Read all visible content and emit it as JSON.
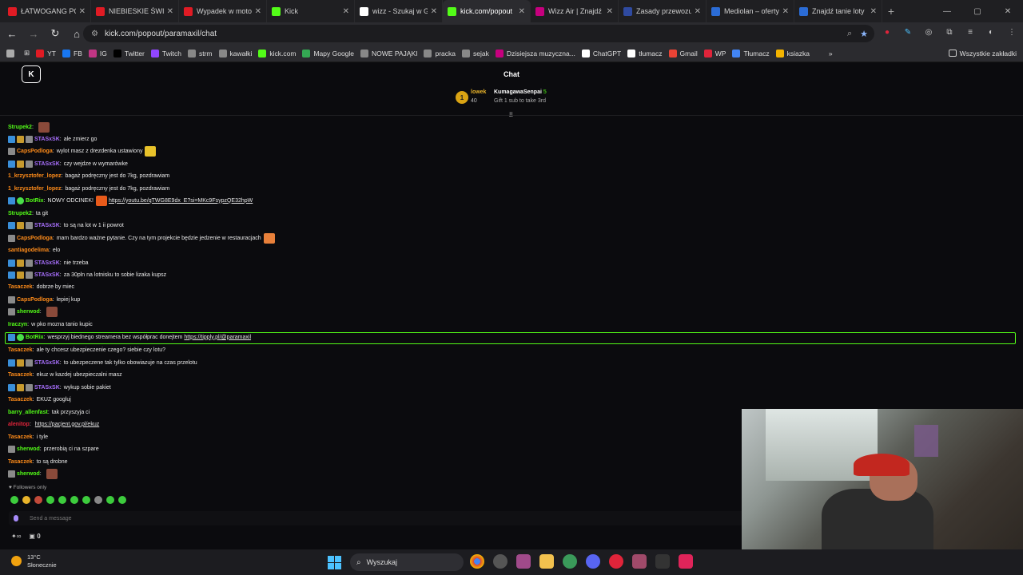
{
  "browser": {
    "tabs": [
      {
        "label": "ŁATWOGANG PO",
        "color": "#e01b24"
      },
      {
        "label": "NIEBIESKIE ŚWIAT",
        "color": "#e01b24"
      },
      {
        "label": "Wypadek w moto",
        "color": "#e01b24"
      },
      {
        "label": "Kick",
        "color": "#53fc18"
      },
      {
        "label": "wizz - Szukaj w G",
        "color": "#ffffff"
      },
      {
        "label": "kick.com/popout",
        "color": "#53fc18"
      },
      {
        "label": "Wizz Air | Znajdź",
        "color": "#c6007e"
      },
      {
        "label": "Zasady przewozu",
        "color": "#2f4aa0"
      },
      {
        "label": "Mediolan – oferty",
        "color": "#2b6cd6"
      },
      {
        "label": "Znajdź tanie loty",
        "color": "#2b6cd6"
      }
    ],
    "active_tab": 5,
    "url": "kick.com/popout/paramaxil/chat",
    "bookmarks": [
      "YT",
      "FB",
      "IG",
      "Twitter",
      "Twitch",
      "strm",
      "kawałki",
      "kick.com",
      "Mapy Google",
      "NOWE PAJĄKI",
      "pracka",
      "sejak",
      "Dzisiejsza muzyczna...",
      "ChatGPT",
      "tłumacz",
      "Gmail",
      "WP",
      "Tłumacz",
      "ksiazka"
    ],
    "bookmarks_all": "Wszystkie zakładki"
  },
  "chat": {
    "header": "Chat",
    "pinned": {
      "rank": "1",
      "user": "lowek",
      "amount": "40",
      "gifter": "KumagawaSenpai",
      "gifter_count": "5",
      "sub_text": "Gift 1 sub to take 3rd"
    },
    "messages": [
      {
        "user": "Strupek2",
        "color": "#53fc18",
        "text": "",
        "badges": [],
        "emote": "#8a4a3a"
      },
      {
        "user": "STASxSK",
        "color": "#a970ff",
        "text": "ale zmierz go",
        "badges": [
          "b-blue",
          "b-gold",
          "b-mod"
        ]
      },
      {
        "user": "CapsPodloga",
        "color": "#ff8c1a",
        "text": "wylot masz z drezdenka ustawiony",
        "badges": [
          "b-mod"
        ],
        "emote": "#e8c22a"
      },
      {
        "user": "STASxSK",
        "color": "#a970ff",
        "text": "czy wejdze w wymarówke",
        "badges": [
          "b-blue",
          "b-gold",
          "b-mod"
        ]
      },
      {
        "user": "1_krzysztofer_lopez",
        "color": "#ff8c1a",
        "text": "bagaż podręczny jest do 7kg, pozdrawiam",
        "badges": []
      },
      {
        "user": "1_krzysztofer_lopez",
        "color": "#ff8c1a",
        "text": "bagaż podręczny jest do 7kg, pozdrawiam",
        "badges": []
      },
      {
        "user": "BotRix",
        "color": "#53fc18",
        "text": "NOWY ODCINEK!",
        "badges": [
          "b-blue",
          "b-green"
        ],
        "emote": "#e85a1a",
        "link": "https://youtu.be/qTWG8E9dx_E?si=MKc9FsypzQE32hpW"
      },
      {
        "user": "Strupek2",
        "color": "#53fc18",
        "text": "ta git",
        "badges": []
      },
      {
        "user": "STASxSK",
        "color": "#a970ff",
        "text": "to są na lot w 1 ii powrot",
        "badges": [
          "b-blue",
          "b-gold",
          "b-mod"
        ]
      },
      {
        "user": "CapsPodloga",
        "color": "#ff8c1a",
        "text": "mam bardzo ważne pytanie. Czy na tym projekcie będzie jedzenie w restauracjach",
        "badges": [
          "b-mod"
        ],
        "emote": "#e8803a"
      },
      {
        "user": "santiagodelima",
        "color": "#ff8c1a",
        "text": "elo",
        "badges": []
      },
      {
        "user": "STASxSK",
        "color": "#a970ff",
        "text": "nie trzeba",
        "badges": [
          "b-blue",
          "b-gold",
          "b-mod"
        ]
      },
      {
        "user": "STASxSK",
        "color": "#a970ff",
        "text": "za 30pln na lotnisku to sobie lizaka kupsz",
        "badges": [
          "b-blue",
          "b-gold",
          "b-mod"
        ]
      },
      {
        "user": "Tasaczek",
        "color": "#ff8c1a",
        "text": "dobrze by miec",
        "badges": []
      },
      {
        "user": "CapsPodloga",
        "color": "#ff8c1a",
        "text": "lepiej kup",
        "badges": [
          "b-mod"
        ]
      },
      {
        "user": "sherwod",
        "color": "#53fc18",
        "text": "",
        "badges": [
          "b-mod"
        ],
        "emote": "#8a4a3a"
      },
      {
        "user": "Iraczyn",
        "color": "#53fc18",
        "text": "w pko mozna tanio kupic",
        "badges": []
      },
      {
        "user": "BotRix",
        "color": "#53fc18",
        "text": "wesprzyj biednego streamera bez współprac donejtem",
        "badges": [
          "b-blue",
          "b-green"
        ],
        "link": "https://tipply.pl/@paramaxil"
      },
      {
        "user": "Tasaczek",
        "color": "#ff8c1a",
        "text": "ale ty chcesz ubezpieczenie czego? siebie czy lotu?",
        "badges": []
      },
      {
        "user": "STASxSK",
        "color": "#a970ff",
        "text": "to ubezpeczene tak tylko obowiazuje na czas przelotu",
        "badges": [
          "b-blue",
          "b-gold",
          "b-mod"
        ]
      },
      {
        "user": "Tasaczek",
        "color": "#ff8c1a",
        "text": "ekuz w kazdej ubezpieczalni masz",
        "badges": []
      },
      {
        "user": "STASxSK",
        "color": "#a970ff",
        "text": "wykup sobie pakiet",
        "badges": [
          "b-blue",
          "b-gold",
          "b-mod"
        ]
      },
      {
        "user": "Tasaczek",
        "color": "#ff8c1a",
        "text": "EKUZ googluj",
        "badges": []
      },
      {
        "user": "barry_allenfast",
        "color": "#53fc18",
        "text": "tak przyszyja ci",
        "badges": []
      },
      {
        "user": "alenitop",
        "color": "#e0243a",
        "text": "",
        "badges": [],
        "link": "https://pacjent.gov.pl/ekuz"
      },
      {
        "user": "Tasaczek",
        "color": "#ff8c1a",
        "text": "i tyle",
        "badges": []
      },
      {
        "user": "sherwod",
        "color": "#53fc18",
        "text": "przerobią ci na szpare",
        "badges": [
          "b-mod"
        ]
      },
      {
        "user": "Tasaczek",
        "color": "#ff8c1a",
        "text": "to są drobne",
        "badges": []
      },
      {
        "user": "sherwod",
        "color": "#53fc18",
        "text": "",
        "badges": [
          "b-mod"
        ],
        "emote": "#8a4a3a"
      }
    ],
    "followers_only": "Followers only",
    "input_placeholder": "Send a message",
    "points": "0"
  },
  "taskbar": {
    "temp": "13°C",
    "weather": "Słonecznie",
    "search": "Wyszukaj"
  }
}
